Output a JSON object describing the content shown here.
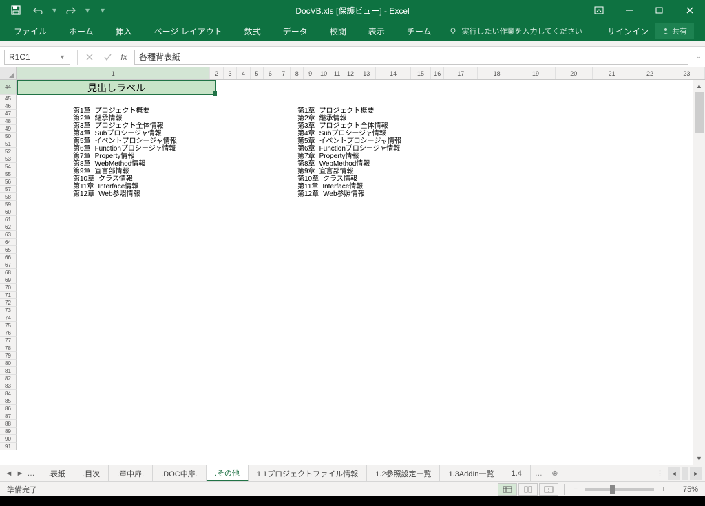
{
  "title": "DocVB.xls [保護ビュー] - Excel",
  "ribbon": {
    "tabs": [
      "ファイル",
      "ホーム",
      "挿入",
      "ページ レイアウト",
      "数式",
      "データ",
      "校閲",
      "表示",
      "チーム"
    ],
    "tell_me": "実行したい作業を入力してください",
    "signin": "サインイン",
    "share": "共有"
  },
  "formula_bar": {
    "name_box": "R1C1",
    "value": "各種背表紙"
  },
  "rows_start": 44,
  "rows_end": 91,
  "col_headers": [
    1,
    2,
    3,
    4,
    5,
    6,
    7,
    8,
    9,
    10,
    11,
    12,
    13,
    14,
    15,
    16,
    17,
    18,
    19,
    20,
    21,
    22,
    23
  ],
  "selected_cell_text": "見出しラベル",
  "toc": [
    {
      "ch": "第1章",
      "t": "プロジェクト概要"
    },
    {
      "ch": "第2章",
      "t": "継承情報"
    },
    {
      "ch": "第3章",
      "t": "プロジェクト全体情報"
    },
    {
      "ch": "第4章",
      "t": "Subプロシージャ情報"
    },
    {
      "ch": "第5章",
      "t": "イベントプロシージャ情報"
    },
    {
      "ch": "第6章",
      "t": "Functionプロシージャ情報"
    },
    {
      "ch": "第7章",
      "t": "Property情報"
    },
    {
      "ch": "第8章",
      "t": "WebMethod情報"
    },
    {
      "ch": "第9章",
      "t": "宣言部情報"
    },
    {
      "ch": "第10章",
      "t": "クラス情報"
    },
    {
      "ch": "第11章",
      "t": "Interface情報"
    },
    {
      "ch": "第12章",
      "t": "Web参照情報"
    }
  ],
  "sheets": [
    ".表紙",
    ".目次",
    ".章中扉.",
    ".DOC中扉.",
    ".その他",
    "1.1プロジェクトファイル情報",
    "1.2参照設定一覧",
    "1.3AddIn一覧",
    "1.4"
  ],
  "active_sheet": ".その他",
  "status": {
    "ready": "準備完了",
    "zoom": "75%"
  }
}
